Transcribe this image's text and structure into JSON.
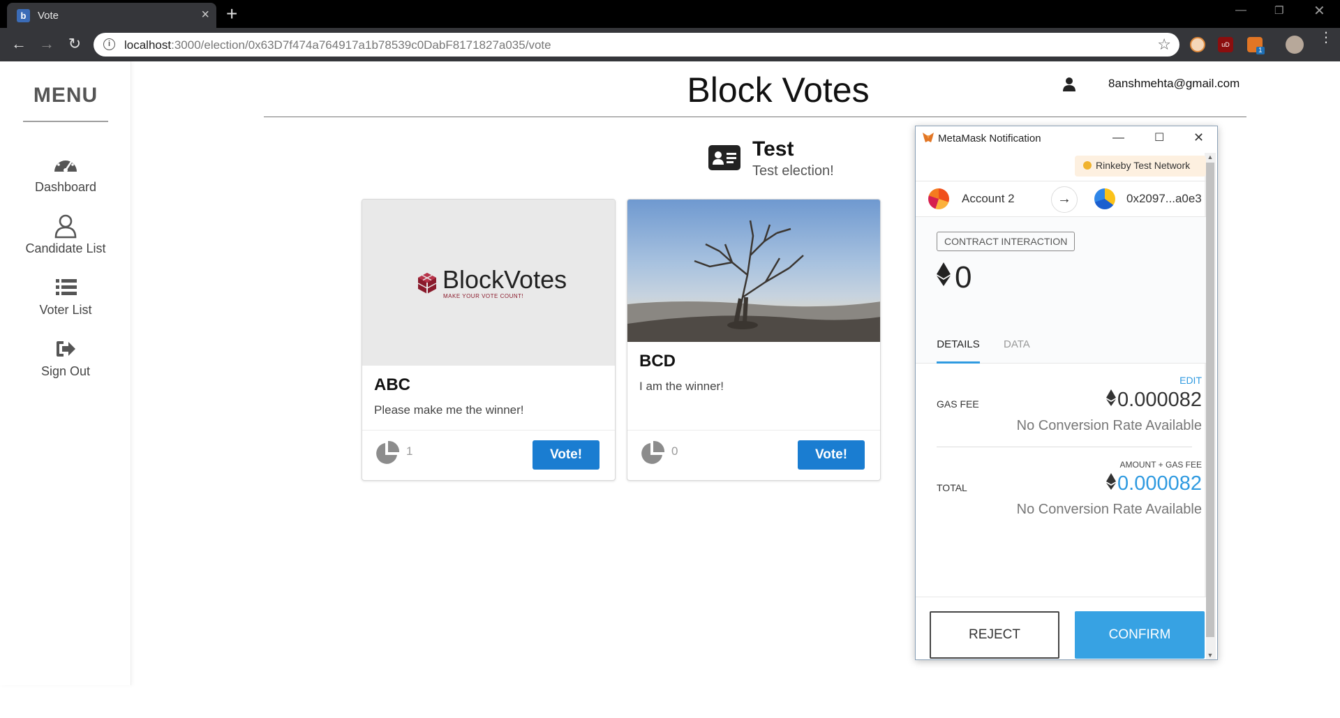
{
  "browser": {
    "tab_title": "Vote",
    "tab_favicon_letter": "b",
    "url_host": "localhost",
    "url_path": ":3000/election/0x63D7f474a764917a1b78539c0DabF8171827a035/vote",
    "extension_badge": "1"
  },
  "sidebar": {
    "menu_title": "MENU",
    "items": [
      {
        "label": "Dashboard"
      },
      {
        "label": "Candidate List"
      },
      {
        "label": "Voter List"
      },
      {
        "label": "Sign Out"
      }
    ]
  },
  "header": {
    "app_title": "Block Votes",
    "user_email": "8anshmehta@gmail.com"
  },
  "election": {
    "name": "Test",
    "description": "Test election!"
  },
  "candidates": [
    {
      "name": "ABC",
      "description": "Please make me the winner!",
      "votes": "1",
      "vote_label": "Vote!",
      "logo_text": "BlockVotes",
      "logo_tagline": "MAKE YOUR VOTE COUNT!"
    },
    {
      "name": "BCD",
      "description": "I am the winner!",
      "votes": "0",
      "vote_label": "Vote!"
    }
  ],
  "metamask": {
    "window_title": "MetaMask Notification",
    "network": "Rinkeby Test Network",
    "account_name": "Account 2",
    "to_address": "0x2097...a0e3",
    "badge": "CONTRACT INTERACTION",
    "amount": "0",
    "tabs": {
      "details": "DETAILS",
      "data": "DATA"
    },
    "edit_label": "EDIT",
    "gas_fee_label": "GAS FEE",
    "gas_fee_value": "0.000082",
    "no_conversion": "No Conversion Rate Available",
    "amount_gas_label": "AMOUNT + GAS FEE",
    "total_label": "TOTAL",
    "total_value": "0.000082",
    "reject_label": "REJECT",
    "confirm_label": "CONFIRM"
  },
  "colors": {
    "primary_button": "#1a7dd1",
    "metamask_accent": "#37a2e3",
    "network_dot": "#f0b32f"
  }
}
